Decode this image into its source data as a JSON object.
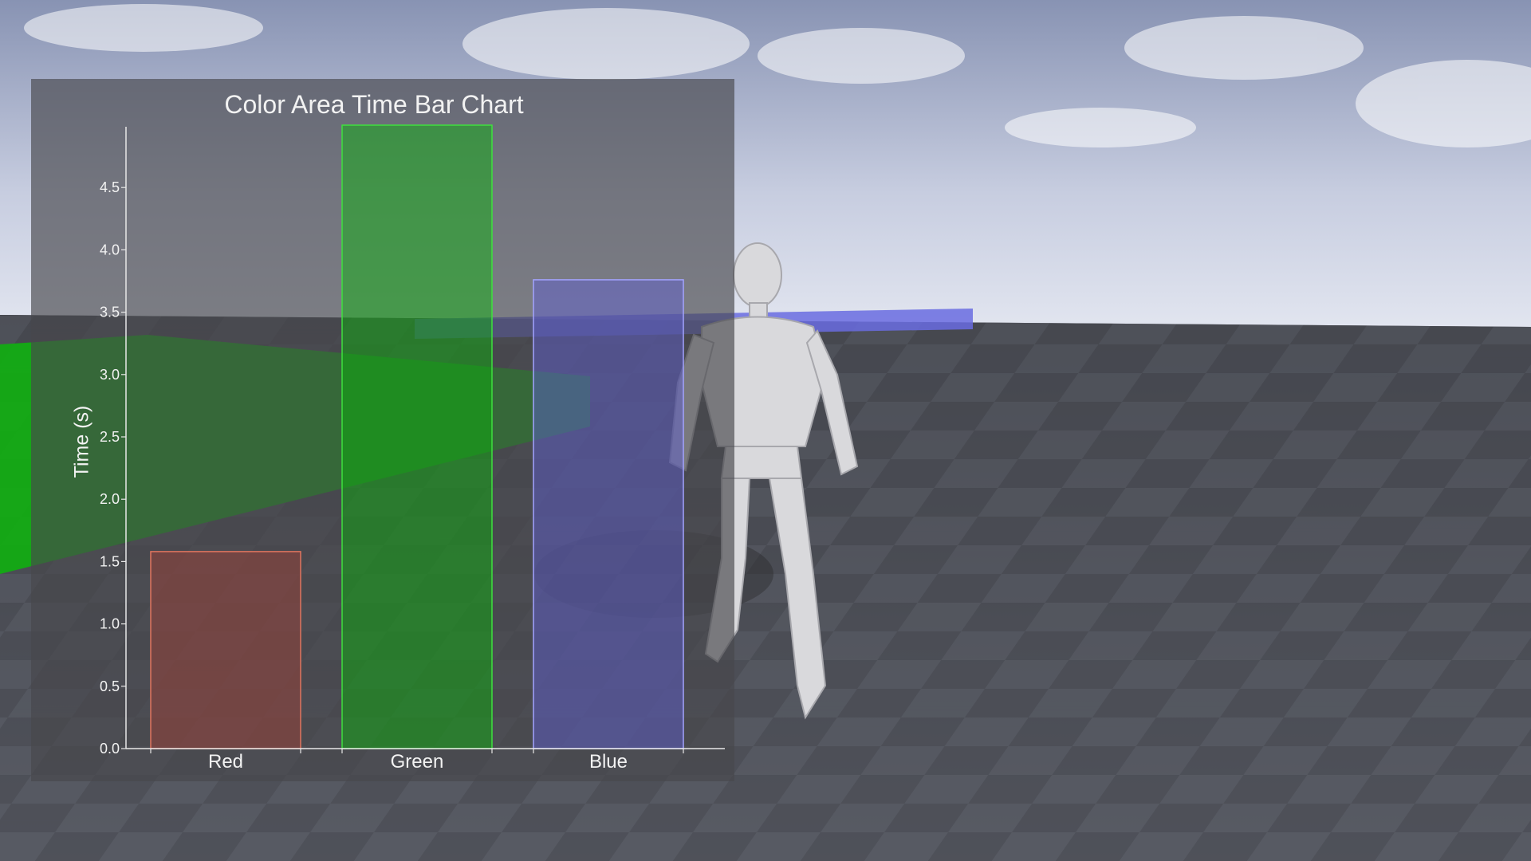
{
  "scene": {
    "description_colors": {
      "sky_top": "#8b95b4",
      "sky_bottom": "#dfe3ee",
      "floor": "#4a4c54"
    }
  },
  "chart_data": {
    "type": "bar",
    "title": "Color Area Time Bar Chart",
    "xlabel": "",
    "ylabel": "Time (s)",
    "categories": [
      "Red",
      "Green",
      "Blue"
    ],
    "values": [
      1.58,
      5.0,
      3.76
    ],
    "ylim": [
      0,
      5.0
    ],
    "yticks": [
      "0.0",
      "0.5",
      "1.0",
      "1.5",
      "2.0",
      "2.5",
      "3.0",
      "3.5",
      "4.0",
      "4.5"
    ],
    "ytick_values": [
      0,
      0.5,
      1,
      1.5,
      2,
      2.5,
      3,
      3.5,
      4,
      4.5
    ],
    "colors": {
      "Red": {
        "fill": "rgba(150,66,58,0.55)",
        "edge": "#e0755f"
      },
      "Green": {
        "fill": "rgba(0,190,0,0.42)",
        "edge": "#3fe03f"
      },
      "Blue": {
        "fill": "rgba(95,95,215,0.45)",
        "edge": "#a3a3ff"
      }
    },
    "grid": false,
    "legend": "none"
  }
}
